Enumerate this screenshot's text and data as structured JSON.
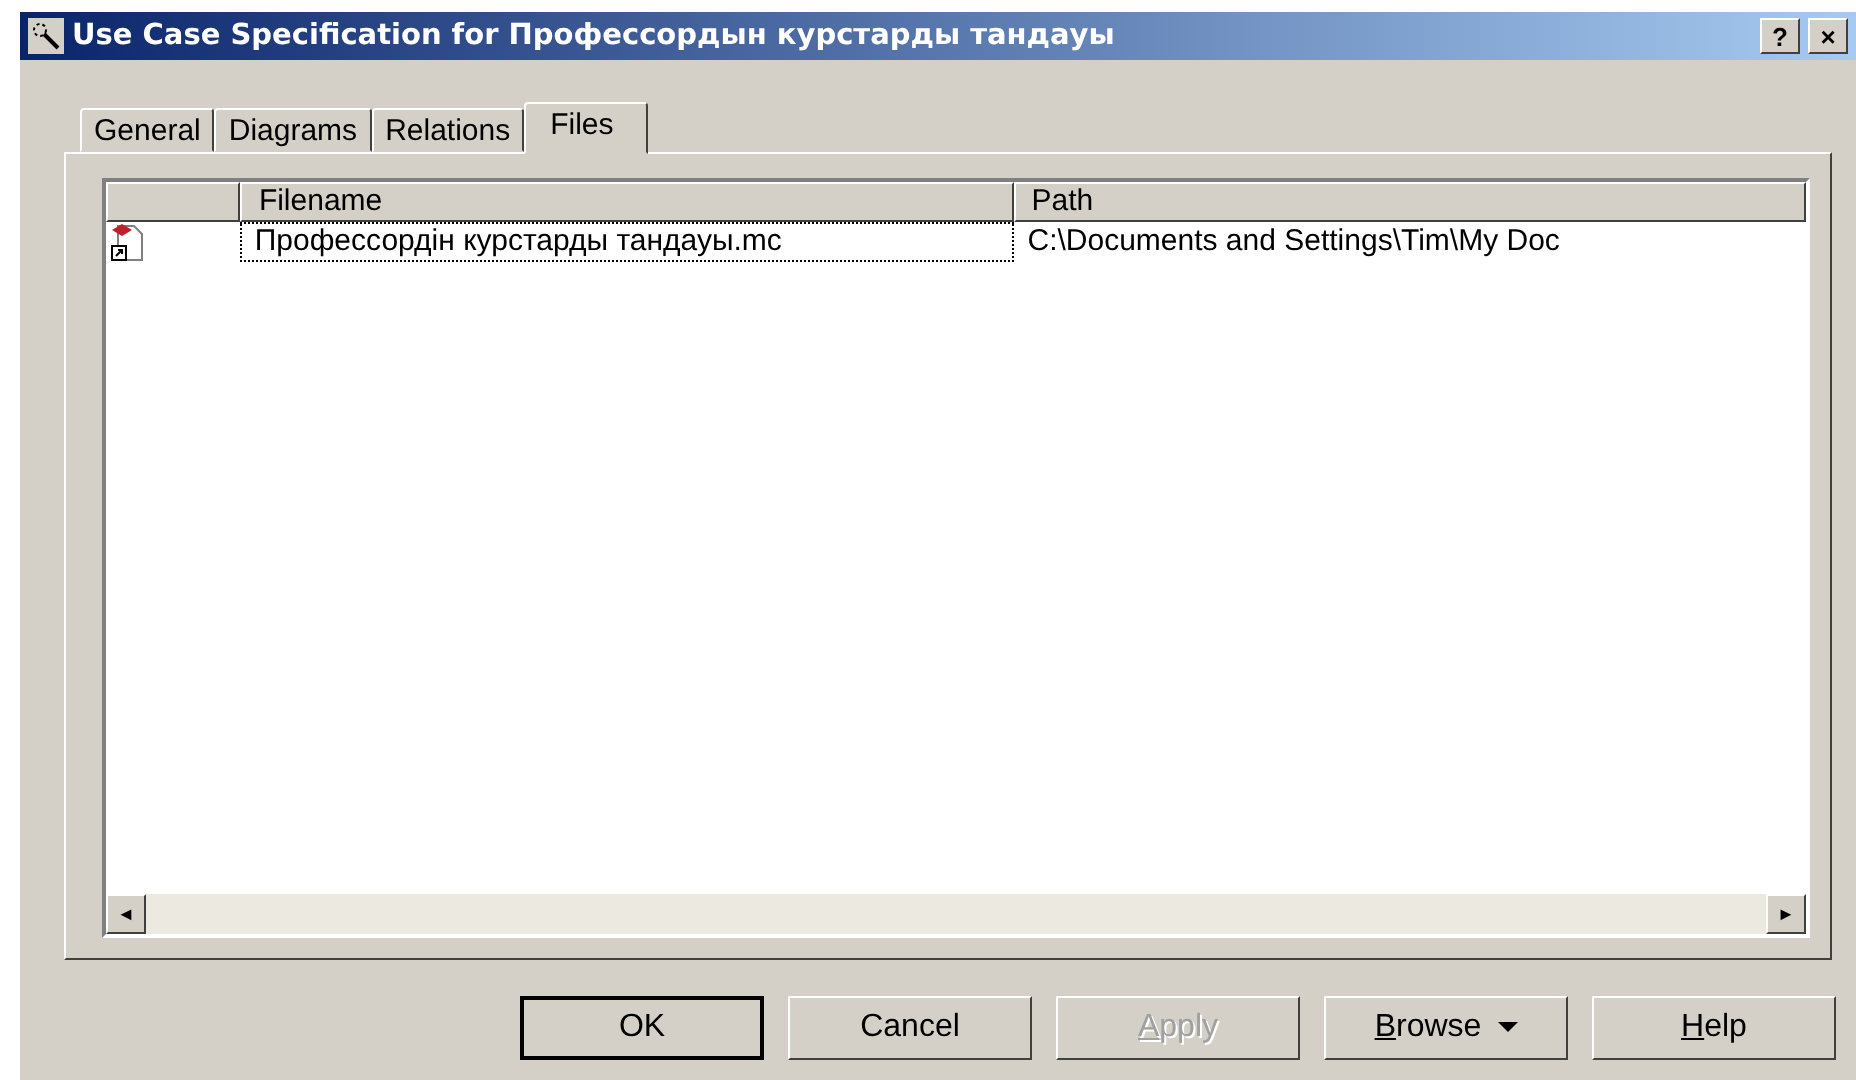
{
  "window": {
    "title": "Use Case Specification for Профессордын курстарды тандауы",
    "title_buttons": [
      "?",
      "×"
    ]
  },
  "tabs": [
    {
      "label": "General",
      "selected": false
    },
    {
      "label": "Diagrams",
      "selected": false
    },
    {
      "label": "Relations",
      "selected": false
    },
    {
      "label": "Files",
      "selected": true
    }
  ],
  "table": {
    "columns": [
      "Filename",
      "Path"
    ],
    "rows": [
      {
        "filename": "Профессордін курстарды тандауы.mc",
        "path": "C:\\Documents and Settings\\Tim\\My Doc",
        "focused": true
      }
    ]
  },
  "scroll_arrows": [
    "◄",
    "►"
  ],
  "buttons": [
    {
      "label": "OK",
      "default": true,
      "disabled": false,
      "underline_first": false
    },
    {
      "label": "Cancel",
      "default": false,
      "disabled": false,
      "underline_first": false
    },
    {
      "label": "Apply",
      "default": false,
      "disabled": true,
      "underline_first": true
    },
    {
      "label": "Browse",
      "default": false,
      "disabled": false,
      "underline_first": true,
      "dropdown": true
    },
    {
      "label": "Help",
      "default": false,
      "disabled": false,
      "underline_first": true
    }
  ]
}
